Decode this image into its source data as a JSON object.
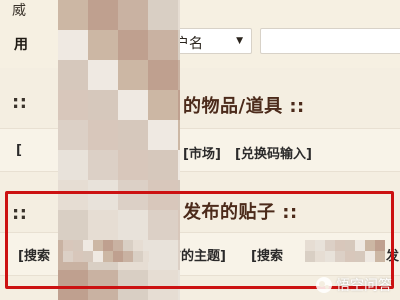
{
  "top_partial_label": "威",
  "user_label_partial": "用",
  "search_type": {
    "selected": "户名",
    "caret": "▼"
  },
  "search_input": {
    "value": "",
    "placeholder": ""
  },
  "items_section": {
    "heading_left": "::",
    "heading_right": "的物品/道具 ::",
    "link_left_partial": "[",
    "market_link": "[市场]",
    "redeem_link": "[兑换码输入]"
  },
  "posts_section": {
    "heading_left": "::",
    "heading_right": "发布的贴子 ::",
    "search_left_prefix": "[搜索 ",
    "search_left_suffix": "发布的主题]",
    "search_right_prefix": "[搜索 ",
    "search_right_suffix": "发"
  },
  "watermark": {
    "text": "悟空问答"
  },
  "colors": {
    "page_background": "#f4eee1",
    "heading_color": "#4b2a1a",
    "highlight_red": "#cc1111",
    "mosaic_tones": [
      "#d9cfc4",
      "#ccb7a4",
      "#d8c7bb",
      "#e6ddd3",
      "#bfa08f",
      "#d6c8bc",
      "#e8e2da",
      "#c9b2a2",
      "#efe9e2",
      "#dcd0c6"
    ]
  },
  "icons": {
    "dropdown": "chevron-down-icon",
    "watermark": "wukong-logo-icon"
  }
}
